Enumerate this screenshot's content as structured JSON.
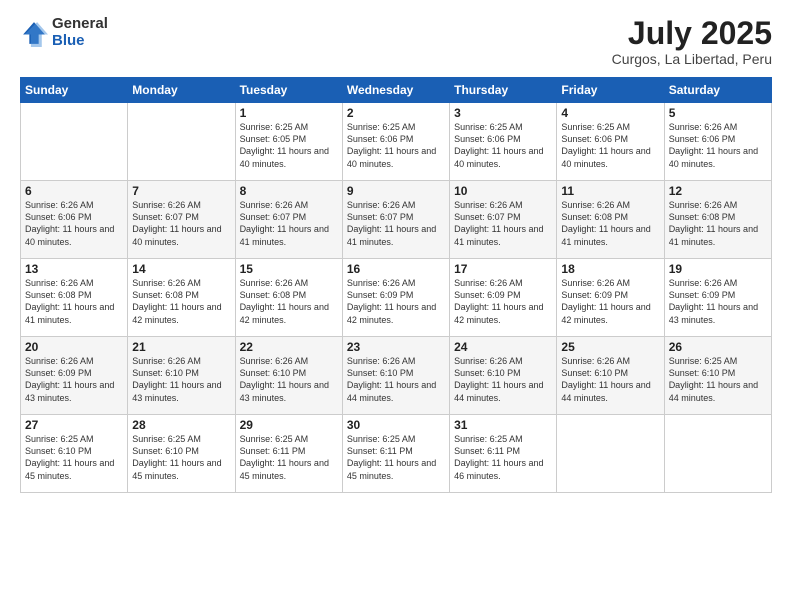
{
  "logo": {
    "general": "General",
    "blue": "Blue"
  },
  "title": {
    "month": "July 2025",
    "location": "Curgos, La Libertad, Peru"
  },
  "headers": [
    "Sunday",
    "Monday",
    "Tuesday",
    "Wednesday",
    "Thursday",
    "Friday",
    "Saturday"
  ],
  "weeks": [
    [
      {
        "day": "",
        "info": ""
      },
      {
        "day": "",
        "info": ""
      },
      {
        "day": "1",
        "info": "Sunrise: 6:25 AM\nSunset: 6:05 PM\nDaylight: 11 hours and 40 minutes."
      },
      {
        "day": "2",
        "info": "Sunrise: 6:25 AM\nSunset: 6:06 PM\nDaylight: 11 hours and 40 minutes."
      },
      {
        "day": "3",
        "info": "Sunrise: 6:25 AM\nSunset: 6:06 PM\nDaylight: 11 hours and 40 minutes."
      },
      {
        "day": "4",
        "info": "Sunrise: 6:25 AM\nSunset: 6:06 PM\nDaylight: 11 hours and 40 minutes."
      },
      {
        "day": "5",
        "info": "Sunrise: 6:26 AM\nSunset: 6:06 PM\nDaylight: 11 hours and 40 minutes."
      }
    ],
    [
      {
        "day": "6",
        "info": "Sunrise: 6:26 AM\nSunset: 6:06 PM\nDaylight: 11 hours and 40 minutes."
      },
      {
        "day": "7",
        "info": "Sunrise: 6:26 AM\nSunset: 6:07 PM\nDaylight: 11 hours and 40 minutes."
      },
      {
        "day": "8",
        "info": "Sunrise: 6:26 AM\nSunset: 6:07 PM\nDaylight: 11 hours and 41 minutes."
      },
      {
        "day": "9",
        "info": "Sunrise: 6:26 AM\nSunset: 6:07 PM\nDaylight: 11 hours and 41 minutes."
      },
      {
        "day": "10",
        "info": "Sunrise: 6:26 AM\nSunset: 6:07 PM\nDaylight: 11 hours and 41 minutes."
      },
      {
        "day": "11",
        "info": "Sunrise: 6:26 AM\nSunset: 6:08 PM\nDaylight: 11 hours and 41 minutes."
      },
      {
        "day": "12",
        "info": "Sunrise: 6:26 AM\nSunset: 6:08 PM\nDaylight: 11 hours and 41 minutes."
      }
    ],
    [
      {
        "day": "13",
        "info": "Sunrise: 6:26 AM\nSunset: 6:08 PM\nDaylight: 11 hours and 41 minutes."
      },
      {
        "day": "14",
        "info": "Sunrise: 6:26 AM\nSunset: 6:08 PM\nDaylight: 11 hours and 42 minutes."
      },
      {
        "day": "15",
        "info": "Sunrise: 6:26 AM\nSunset: 6:08 PM\nDaylight: 11 hours and 42 minutes."
      },
      {
        "day": "16",
        "info": "Sunrise: 6:26 AM\nSunset: 6:09 PM\nDaylight: 11 hours and 42 minutes."
      },
      {
        "day": "17",
        "info": "Sunrise: 6:26 AM\nSunset: 6:09 PM\nDaylight: 11 hours and 42 minutes."
      },
      {
        "day": "18",
        "info": "Sunrise: 6:26 AM\nSunset: 6:09 PM\nDaylight: 11 hours and 42 minutes."
      },
      {
        "day": "19",
        "info": "Sunrise: 6:26 AM\nSunset: 6:09 PM\nDaylight: 11 hours and 43 minutes."
      }
    ],
    [
      {
        "day": "20",
        "info": "Sunrise: 6:26 AM\nSunset: 6:09 PM\nDaylight: 11 hours and 43 minutes."
      },
      {
        "day": "21",
        "info": "Sunrise: 6:26 AM\nSunset: 6:10 PM\nDaylight: 11 hours and 43 minutes."
      },
      {
        "day": "22",
        "info": "Sunrise: 6:26 AM\nSunset: 6:10 PM\nDaylight: 11 hours and 43 minutes."
      },
      {
        "day": "23",
        "info": "Sunrise: 6:26 AM\nSunset: 6:10 PM\nDaylight: 11 hours and 44 minutes."
      },
      {
        "day": "24",
        "info": "Sunrise: 6:26 AM\nSunset: 6:10 PM\nDaylight: 11 hours and 44 minutes."
      },
      {
        "day": "25",
        "info": "Sunrise: 6:26 AM\nSunset: 6:10 PM\nDaylight: 11 hours and 44 minutes."
      },
      {
        "day": "26",
        "info": "Sunrise: 6:25 AM\nSunset: 6:10 PM\nDaylight: 11 hours and 44 minutes."
      }
    ],
    [
      {
        "day": "27",
        "info": "Sunrise: 6:25 AM\nSunset: 6:10 PM\nDaylight: 11 hours and 45 minutes."
      },
      {
        "day": "28",
        "info": "Sunrise: 6:25 AM\nSunset: 6:10 PM\nDaylight: 11 hours and 45 minutes."
      },
      {
        "day": "29",
        "info": "Sunrise: 6:25 AM\nSunset: 6:11 PM\nDaylight: 11 hours and 45 minutes."
      },
      {
        "day": "30",
        "info": "Sunrise: 6:25 AM\nSunset: 6:11 PM\nDaylight: 11 hours and 45 minutes."
      },
      {
        "day": "31",
        "info": "Sunrise: 6:25 AM\nSunset: 6:11 PM\nDaylight: 11 hours and 46 minutes."
      },
      {
        "day": "",
        "info": ""
      },
      {
        "day": "",
        "info": ""
      }
    ]
  ]
}
